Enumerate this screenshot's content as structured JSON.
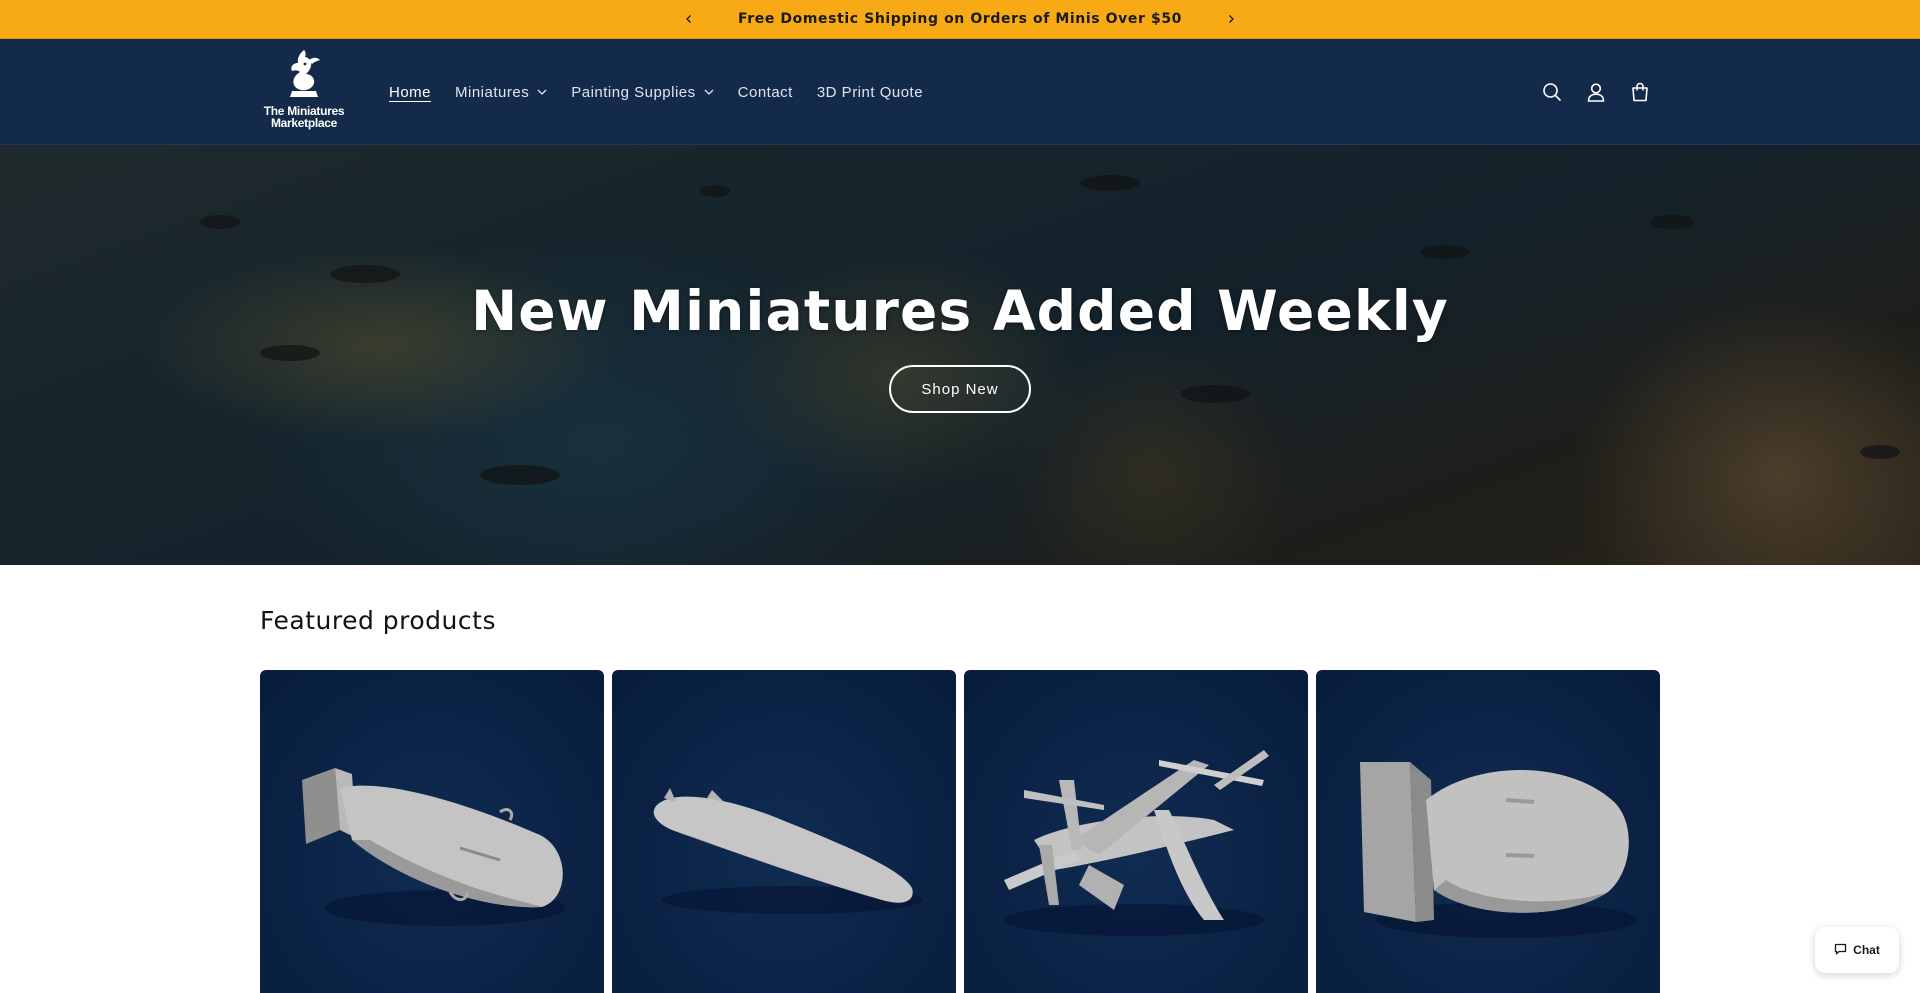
{
  "announcement": {
    "text": "Free Domestic Shipping on Orders of Minis Over $50",
    "prev_icon": "chevron-left-icon",
    "next_icon": "chevron-right-icon"
  },
  "header": {
    "logo_line1": "The Miniatures",
    "logo_line2": "Marketplace",
    "nav": [
      {
        "label": "Home",
        "active": true,
        "dropdown": false
      },
      {
        "label": "Miniatures",
        "active": false,
        "dropdown": true
      },
      {
        "label": "Painting Supplies",
        "active": false,
        "dropdown": true
      },
      {
        "label": "Contact",
        "active": false,
        "dropdown": false
      },
      {
        "label": "3D Print Quote",
        "active": false,
        "dropdown": false
      }
    ],
    "icons": [
      "search-icon",
      "account-icon",
      "cart-icon"
    ]
  },
  "hero": {
    "title": "New Miniatures Added Weekly",
    "button_label": "Shop New"
  },
  "featured": {
    "title": "Featured products",
    "products": [
      {
        "image": "bomb-model-image"
      },
      {
        "image": "submarine-model-image"
      },
      {
        "image": "tiltrotor-aircraft-model-image"
      },
      {
        "image": "fat-bomb-model-image"
      }
    ]
  },
  "chat": {
    "label": "Chat"
  },
  "colors": {
    "announcement_bg": "#f8aa16",
    "header_bg": "#132a4a",
    "card_bg": "#0d2649"
  }
}
